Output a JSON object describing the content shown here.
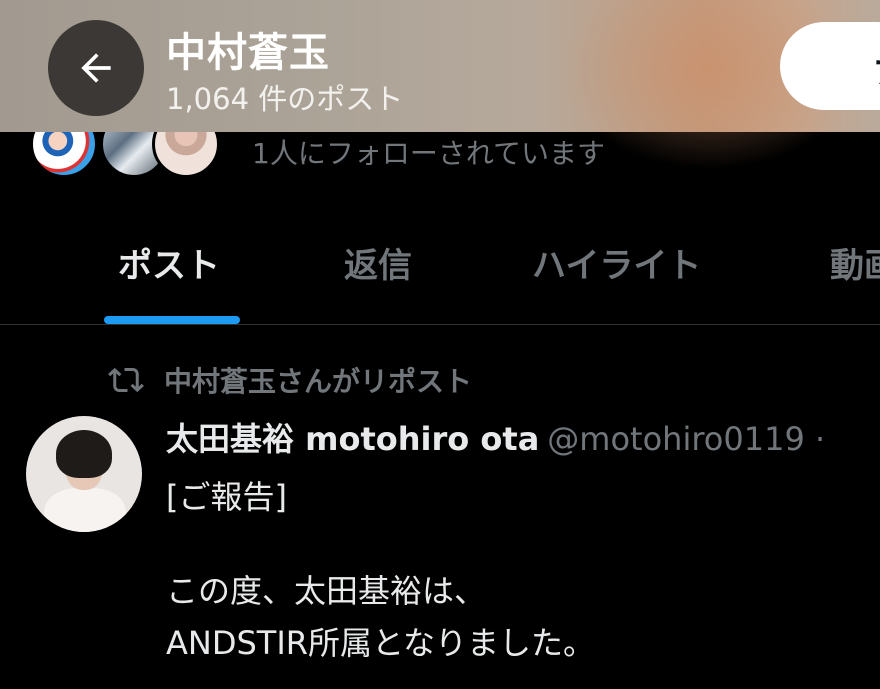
{
  "header": {
    "title": "中村蒼玉",
    "subtitle": "1,064 件のポスト",
    "follow_label": "フ"
  },
  "followers": {
    "text": "1人にフォローされています"
  },
  "tabs": [
    {
      "label": "ポスト",
      "active": true
    },
    {
      "label": "返信",
      "active": false
    },
    {
      "label": "ハイライト",
      "active": false
    },
    {
      "label": "動画",
      "active": false
    }
  ],
  "tweet": {
    "repost_text": "中村蒼玉さんがリポスト",
    "author_name": "太田基裕 motohiro ota",
    "author_handle": "@motohiro0119 ·",
    "lines": [
      "[ご報告]",
      "この度、太田基裕は、",
      "ANDSTIR所属となりました。"
    ]
  },
  "colors": {
    "accent": "#1d9bf0",
    "muted": "#71767b",
    "text": "#e7e9ea",
    "background": "#000000"
  },
  "icons": {
    "back": "arrow-left-icon",
    "repost": "repost-icon"
  }
}
